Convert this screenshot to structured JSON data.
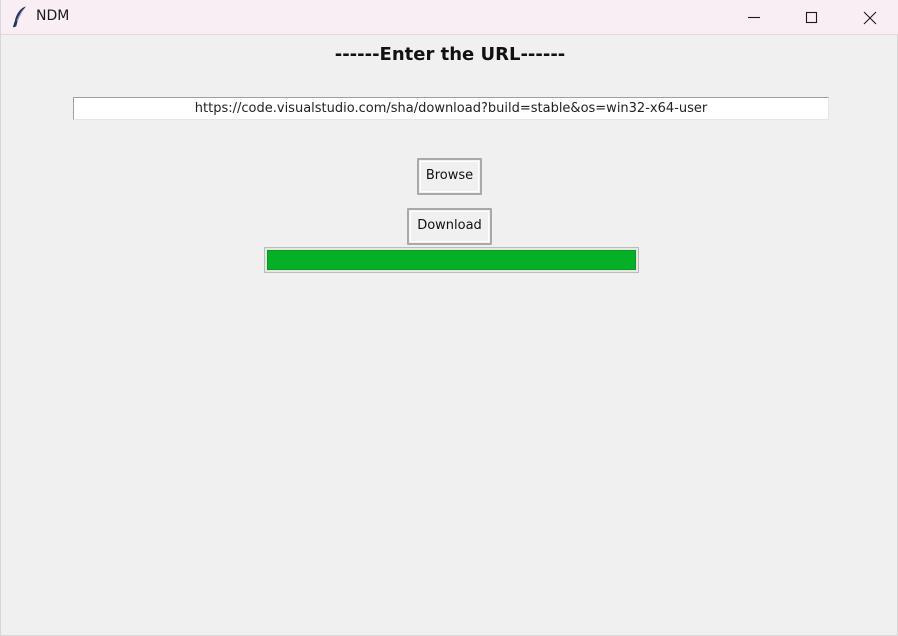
{
  "window": {
    "title": "NDM",
    "icon": "feather-icon",
    "controls": [
      "minimize-icon",
      "maximize-icon",
      "close-icon"
    ]
  },
  "main": {
    "heading": "------Enter the URL------",
    "url_value": "https://code.visualstudio.com/sha/download?build=stable&os=win32-x64-user",
    "browse_label": "Browse",
    "download_label": "Download",
    "progress_fraction": 1.0
  },
  "colors": {
    "progress_fill": "#06b025",
    "titlebar": "#f9eef3",
    "background": "#f0f0f0"
  }
}
